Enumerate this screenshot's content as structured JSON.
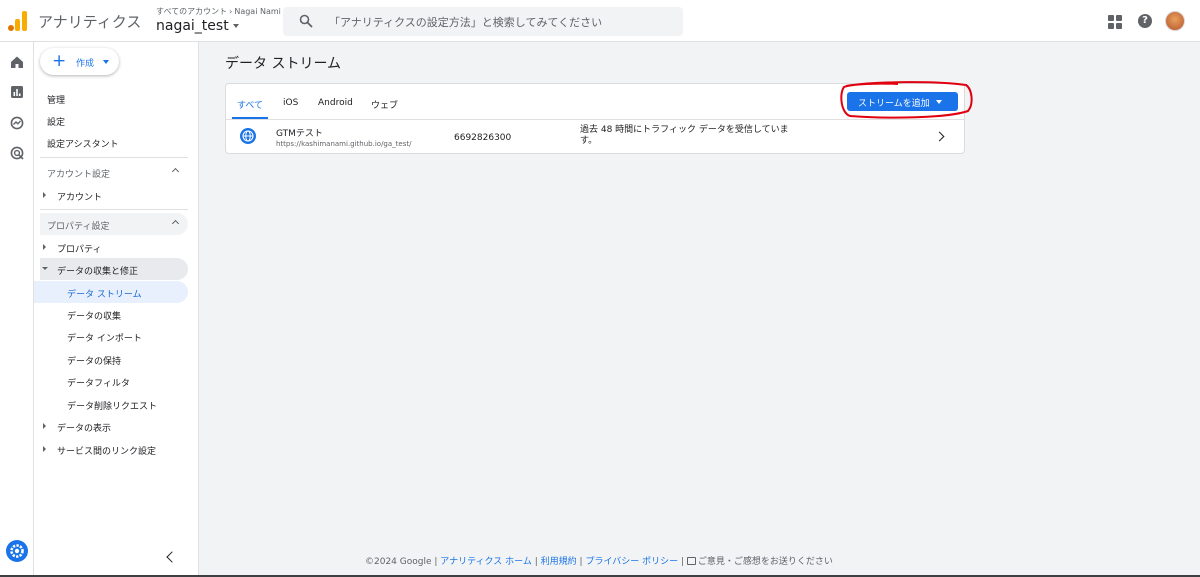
{
  "header": {
    "app_title": "アナリティクス",
    "breadcrumb_all": "すべてのアカウント",
    "breadcrumb_account": "Nagai Nami",
    "property": "nagai_test",
    "search_placeholder": "「アナリティクスの設定方法」と検索してみてください"
  },
  "sidebar": {
    "create_label": "作成",
    "top_items": [
      "管理",
      "設定",
      "設定アシスタント"
    ],
    "account_section": "アカウント設定",
    "account_items": [
      "アカウント"
    ],
    "property_section": "プロパティ設定",
    "property_item": "プロパティ",
    "data_collection": "データの収集と修正",
    "data_collection_children": [
      "データ ストリーム",
      "データの収集",
      "データ インポート",
      "データの保持",
      "データフィルタ",
      "データ削除リクエスト"
    ],
    "other_items": [
      "データの表示",
      "サービス間のリンク設定"
    ]
  },
  "main": {
    "title": "データ ストリーム",
    "tabs": [
      "すべて",
      "iOS",
      "Android",
      "ウェブ"
    ],
    "add_stream_label": "ストリームを追加",
    "stream": {
      "name": "GTMテスト",
      "url": "https://kashimanami.github.io/ga_test/",
      "id": "6692826300",
      "status": "過去 48 時間にトラフィック データを受信しています。"
    }
  },
  "footer": {
    "copyright": "©2024 Google",
    "link_home": "アナリティクス ホーム",
    "link_terms": "利用規約",
    "link_privacy": "プライバシー ポリシー",
    "feedback": "ご意見・ご感想をお送りください"
  },
  "colors": {
    "accent": "#1a73e8",
    "annotation": "#e0000f",
    "logo_orange": "#f9ab00",
    "logo_dark": "#e37400"
  }
}
